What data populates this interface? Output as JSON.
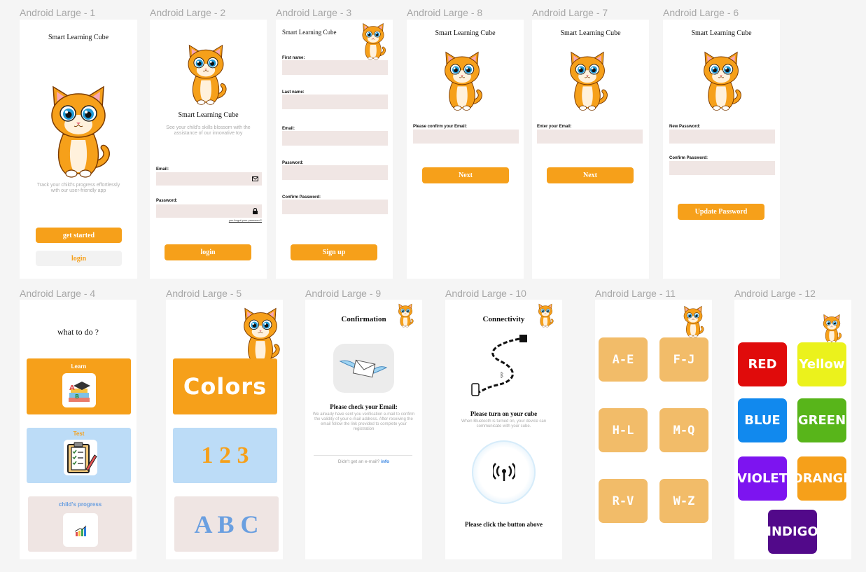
{
  "app_title": "Smart Learning Cube",
  "frames": {
    "f1": {
      "label": "Android Large - 1",
      "title": "Smart Learning Cube",
      "subtitle": "Track your child's progress effortlessly with our user-friendly app",
      "primary": "get started",
      "secondary": "login"
    },
    "f2": {
      "label": "Android Large - 2",
      "title": "Smart Learning Cube",
      "subtitle": "See your child's skills blossom with the assistance of our innovative toy",
      "email_label": "Email:",
      "password_label": "Password:",
      "forgot": "you forgot your password?",
      "login": "login"
    },
    "f3": {
      "label": "Android Large - 3",
      "title": "Smart Learning Cube",
      "first": "First name:",
      "last": "Last name:",
      "email": "Email:",
      "password": "Password:",
      "confirm": "Confirm Password:",
      "signup": "Sign up"
    },
    "f8": {
      "label": "Android Large - 8",
      "title": "Smart Learning Cube",
      "field": "Please confirm your Email:",
      "next": "Next"
    },
    "f7": {
      "label": "Android Large - 7",
      "title": "Smart Learning Cube",
      "field": "Enter your Email:",
      "next": "Next"
    },
    "f6": {
      "label": "Android Large - 6",
      "title": "Smart Learning Cube",
      "new": "New Password:",
      "confirm": "Confirm Password:",
      "update": "Update Password"
    },
    "f4": {
      "label": "Android Large - 4",
      "heading": "what to do ?",
      "learn": "Learn",
      "test": "Test",
      "progress": "child's progress"
    },
    "f5": {
      "label": "Android Large - 5",
      "colors": "Colors",
      "numbers": "1 2 3",
      "letters": "A B C"
    },
    "f9": {
      "label": "Android Large - 9",
      "heading": "Confirmation",
      "check": "Please check your Email:",
      "body": "We already have sent you verification e-mail to confirm the validity of your e-mail address. After receiving the email follow the link provided to complete your registration",
      "prompt": "Didn't get an e-mail?",
      "link": "info"
    },
    "f10": {
      "label": "Android Large - 10",
      "heading": "Connectivity",
      "turn_on": "Please turn on your cube",
      "body": "When Bluetooth is turned on, your device can communicate with your cube.",
      "click": "Please click the button above"
    },
    "f11": {
      "label": "Android Large - 11",
      "tiles": [
        "A-E",
        "F-J",
        "H-L",
        "M-Q",
        "R-V",
        "W-Z"
      ]
    },
    "f12": {
      "label": "Android Large - 12",
      "tiles": [
        {
          "text": "RED",
          "color": "#e00b0b"
        },
        {
          "text": "Yellow",
          "color": "#ebf21c"
        },
        {
          "text": "BLUE",
          "color": "#1189ee"
        },
        {
          "text": "GREEN",
          "color": "#58b51a"
        },
        {
          "text": "VIOLET",
          "color": "#7d14f0"
        },
        {
          "text": "ORANGE",
          "color": "#f6a01a"
        },
        {
          "text": "INDIGO",
          "color": "#52098a"
        }
      ]
    }
  },
  "colors": {
    "accent": "#f6a01a",
    "field": "#f0e6e4",
    "tile": "#f2bc69"
  }
}
